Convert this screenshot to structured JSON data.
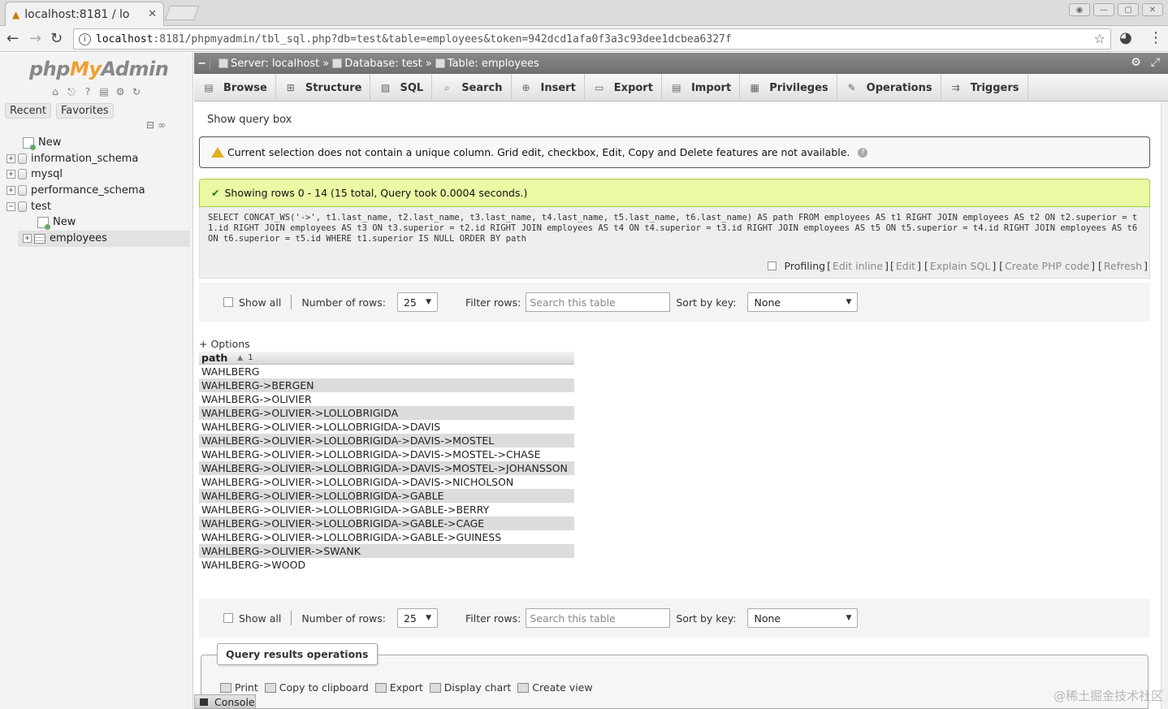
{
  "browser": {
    "tab_title": "localhost:8181 / lo",
    "url_host": "localhost",
    "url_rest": ":8181/phpmyadmin/tbl_sql.php?db=test&table=employees&token=942dcd1afa0f3a3c93dee1dcbea6327f"
  },
  "nav": {
    "logo_php": "php",
    "logo_my": "My",
    "logo_admin": "Admin",
    "recent": "Recent",
    "favorites": "Favorites",
    "tree": {
      "new_root": "New",
      "information_schema": "information_schema",
      "mysql": "mysql",
      "performance_schema": "performance_schema",
      "test": "test",
      "new_test": "New",
      "employees": "employees"
    }
  },
  "breadcrumb": {
    "server": "Server: localhost",
    "database": "Database: test",
    "table": "Table: employees",
    "sep": "»"
  },
  "tabs": [
    "Browse",
    "Structure",
    "SQL",
    "Search",
    "Insert",
    "Export",
    "Import",
    "Privileges",
    "Operations",
    "Triggers"
  ],
  "show_query_box": "Show query box",
  "notice": "Current selection does not contain a unique column. Grid edit, checkbox, Edit, Copy and Delete features are not available.",
  "success": "Showing rows 0 - 14 (15 total, Query took 0.0004 seconds.)",
  "sql": "SELECT CONCAT_WS('->', t1.last_name, t2.last_name, t3.last_name, t4.last_name, t5.last_name, t6.last_name) AS path FROM employees AS t1 RIGHT JOIN employees AS t2 ON t2.superior = t1.id RIGHT JOIN employees AS t3 ON t3.superior = t2.id RIGHT JOIN employees AS t4 ON t4.superior = t3.id RIGHT JOIN employees AS t5 ON t5.superior = t4.id RIGHT JOIN employees AS t6 ON t6.superior = t5.id WHERE t1.superior IS NULL ORDER BY path",
  "sql_links": {
    "profiling": "Profiling",
    "edit_inline": "Edit inline",
    "edit": "Edit",
    "explain": "Explain SQL",
    "php": "Create PHP code",
    "refresh": "Refresh"
  },
  "nav_controls": {
    "show_all": "Show all",
    "num_rows_label": "Number of rows:",
    "num_rows_value": "25",
    "filter_label": "Filter rows:",
    "filter_placeholder": "Search this table",
    "sort_label": "Sort by key:",
    "sort_value": "None"
  },
  "options": "+ Options",
  "results": {
    "column": "path",
    "sort_num": "1",
    "rows": [
      "WAHLBERG",
      "WAHLBERG->BERGEN",
      "WAHLBERG->OLIVIER",
      "WAHLBERG->OLIVIER->LOLLOBRIGIDA",
      "WAHLBERG->OLIVIER->LOLLOBRIGIDA->DAVIS",
      "WAHLBERG->OLIVIER->LOLLOBRIGIDA->DAVIS->MOSTEL",
      "WAHLBERG->OLIVIER->LOLLOBRIGIDA->DAVIS->MOSTEL->CHASE",
      "WAHLBERG->OLIVIER->LOLLOBRIGIDA->DAVIS->MOSTEL->JOHANSSON",
      "WAHLBERG->OLIVIER->LOLLOBRIGIDA->DAVIS->NICHOLSON",
      "WAHLBERG->OLIVIER->LOLLOBRIGIDA->GABLE",
      "WAHLBERG->OLIVIER->LOLLOBRIGIDA->GABLE->BERRY",
      "WAHLBERG->OLIVIER->LOLLOBRIGIDA->GABLE->CAGE",
      "WAHLBERG->OLIVIER->LOLLOBRIGIDA->GABLE->GUINESS",
      "WAHLBERG->OLIVIER->SWANK",
      "WAHLBERG->WOOD"
    ]
  },
  "qro": {
    "legend": "Query results operations",
    "print": "Print",
    "copy": "Copy to clipboard",
    "export": "Export",
    "chart": "Display chart",
    "view": "Create view"
  },
  "console": "Console",
  "watermark": "@稀土掘金技术社区"
}
